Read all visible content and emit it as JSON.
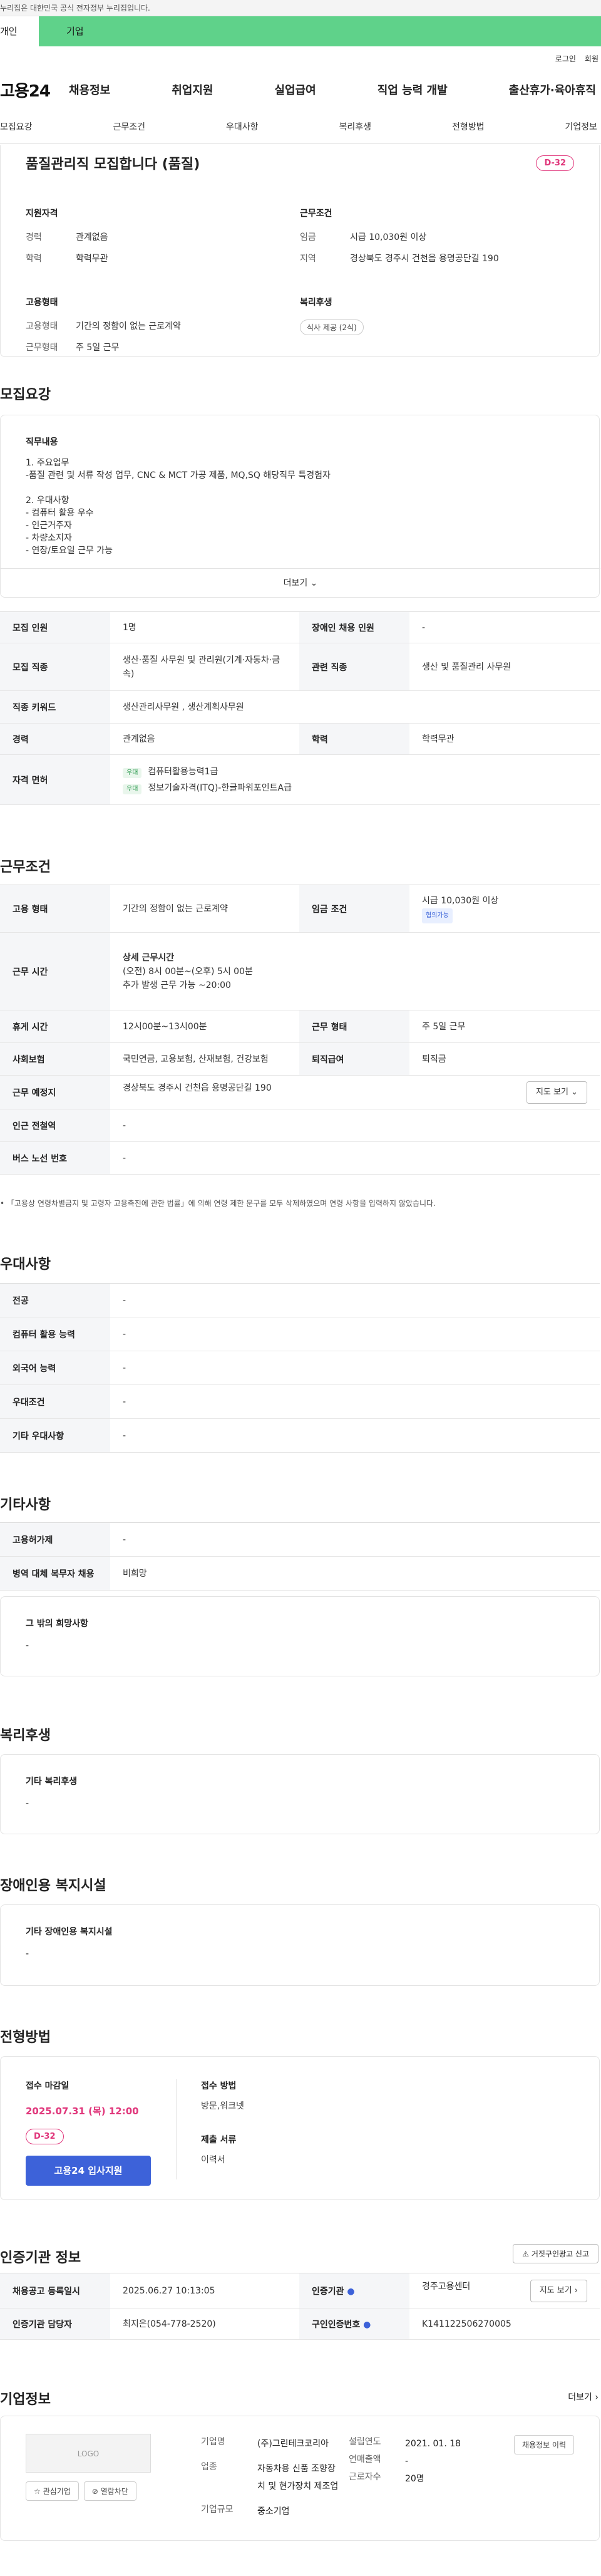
{
  "gov_banner": "누리집은 대한민국 공식 전자정부 누리집입니다.",
  "usertabs": {
    "personal": "개인",
    "company": "기업"
  },
  "util": {
    "login": "로그인",
    "join": "회원"
  },
  "logo": "고용24",
  "gnb": [
    "채용정보",
    "취업지원",
    "실업급여",
    "직업 능력 개발",
    "출산휴가·육아휴직"
  ],
  "subtabs": [
    "모집요강",
    "근무조건",
    "우대사항",
    "복리후생",
    "전형방법",
    "기업정보"
  ],
  "summary": {
    "title": "품질관리직 모집합니다 (품질)",
    "dday": "D-32",
    "qual": {
      "heading": "지원자격",
      "career_k": "경력",
      "career_v": "관계없음",
      "edu_k": "학력",
      "edu_v": "학력무관"
    },
    "cond": {
      "heading": "근무조건",
      "wage_k": "임금",
      "wage_v": "시급 10,030원 이상",
      "area_k": "지역",
      "area_v": "경상북도 경주시 건천읍 용명공단길 190"
    },
    "emp": {
      "heading": "고용형태",
      "type_k": "고용형태",
      "type_v": "기간의 정함이 없는 근로계약",
      "shift_k": "근무형태",
      "shift_v": "주 5일 근무"
    },
    "welfare": {
      "heading": "복리후생",
      "chip": "식사 제공 (2식)"
    }
  },
  "recruit": {
    "title": "모집요강",
    "jobdesc_label": "직무내용",
    "jobdesc": "1. 주요업무\n-품질 관련 및 서류 작성 업무, CNC & MCT 가공 제품, MQ,SQ 해당직무 특경험자\n\n2. 우대사항\n- 컴퓨터 활용 우수\n- 인근거주자\n- 차량소지자\n- 연장/토요일 근무 가능",
    "more": "더보기",
    "rows": {
      "count_k": "모집 인원",
      "count_v": "1명",
      "dis_k": "장애인 채용 인원",
      "dis_v": "-",
      "job_k": "모집 직종",
      "job_v": "생산·품질 사무원 및 관리원(기계·자동차·금속)",
      "rel_k": "관련 직종",
      "rel_v": "생산 및 품질관리 사무원",
      "kw_k": "직종 키워드",
      "kw_v": "생산관리사무원 , 생산계획사무원",
      "career_k": "경력",
      "career_v": "관계없음",
      "edu_k": "학력",
      "edu_v": "학력무관",
      "lic_k": "자격 면허",
      "lic1_tag": "우대",
      "lic1": "컴퓨터활용능력1급",
      "lic2_tag": "우대",
      "lic2": "정보기술자격(ITQ)-한글파워포인트A급"
    }
  },
  "work": {
    "title": "근무조건",
    "type_k": "고용 형태",
    "type_v": "기간의 정함이 없는 근로계약",
    "wage_k": "임금 조건",
    "wage_v": "시급 10,030원 이상",
    "wage_chip": "협의가능",
    "time_k": "근무 시간",
    "time_h": "상세 근무시간",
    "time_1": "(오전) 8시 00분~(오후) 5시 00분",
    "time_2": "추가 발생  근무 가능 ~20:00",
    "break_k": "휴게 시간",
    "break_v": "12시00분~13시00분",
    "form_k": "근무 형태",
    "form_v": "주 5일 근무",
    "ins_k": "사회보험",
    "ins_v": "국민연금, 고용보험, 산재보험, 건강보험",
    "sev_k": "퇴직급여",
    "sev_v": "퇴직금",
    "place_k": "근무 예정지",
    "place_v": "경상북도 경주시 건천읍 용명공단길 190",
    "map_btn": "지도 보기",
    "subway_k": "인근 전철역",
    "subway_v": "-",
    "bus_k": "버스 노선 번호",
    "bus_v": "-",
    "note": "「고용상 연령차별금지 및 고령자 고용촉진에 관한 법률」에 의해 연령 제한 문구를 모두 삭제하였으며 연령 사항을 입력하지 않았습니다."
  },
  "pref": {
    "title": "우대사항",
    "major_k": "전공",
    "major_v": "-",
    "pc_k": "컴퓨터 활용 능력",
    "pc_v": "-",
    "lang_k": "외국어 능력",
    "lang_v": "-",
    "cond_k": "우대조건",
    "cond_v": "-",
    "etc_k": "기타 우대사항",
    "etc_v": "-"
  },
  "other": {
    "title": "기타사항",
    "ins_k": "고용허가제",
    "ins_v": "-",
    "mil_k": "병역 대체 복무자 채용",
    "mil_v": "비희망",
    "wish_h": "그 밖의 희망사항",
    "wish_v": "-"
  },
  "welfare": {
    "title": "복리후생",
    "h": "기타 복리후생",
    "v": "-"
  },
  "disability": {
    "title": "장애인용 복지시설",
    "h": "기타 장애인용 복지시설",
    "v": "-"
  },
  "process": {
    "title": "전형방법",
    "deadline_h": "접수 마감일",
    "deadline_v": "2025.07.31 (목) 12:00",
    "dday": "D-32",
    "apply_btn": "고용24 입사지원",
    "method_h": "접수 방법",
    "method_v": "방문,워크넷",
    "docs_h": "제출 서류",
    "docs_v": "이력서"
  },
  "cert": {
    "title": "인증기관 정보",
    "report_btn": "거짓구인광고 신고",
    "reg_k": "채용공고 등록일시",
    "reg_v": "2025.06.27 10:13:05",
    "org_k": "인증기관",
    "org_v": "경주고용센터",
    "map_btn": "지도 보기",
    "mgr_k": "인증기관 담당자",
    "mgr_v": "최지은(054-778-2520)",
    "no_k": "구인인증번호",
    "no_v": "K141122506270005"
  },
  "company": {
    "title": "기업정보",
    "more": "더보기",
    "logo": "LOGO",
    "fav": "관심기업",
    "block": "열람차단",
    "name_k": "기업명",
    "name_v": "(주)그린테크코리아",
    "ind_k": "업종",
    "ind_v": "자동차용 신품 조향장치 및 현가장치 제조업",
    "size_k": "기업규모",
    "size_v": "중소기업",
    "est_k": "설립연도",
    "est_v": "2021. 01. 18",
    "sales_k": "연매출액",
    "sales_v": "-",
    "emp_k": "근로자수",
    "emp_v": "20명",
    "jobs_btn": "채용정보 이력"
  }
}
